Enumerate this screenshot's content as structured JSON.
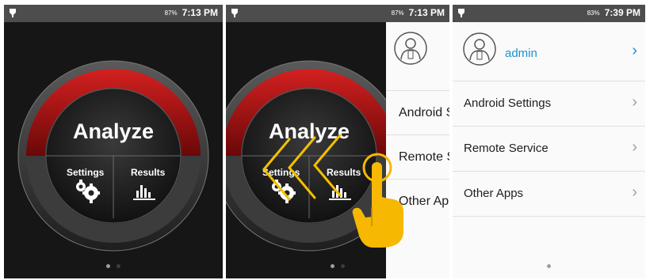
{
  "colors": {
    "accent_red": "#c01818",
    "dial_dark": "#222222",
    "link_blue": "#1e8fcc",
    "hand_yellow": "#f6b800",
    "status_bar": "#4d4d4d"
  },
  "screens": [
    {
      "status": {
        "battery": "87%",
        "time": "7:13 PM",
        "left_icon": "location-pin-icon"
      },
      "dial": {
        "title": "Analyze",
        "left_label": "Settings",
        "right_label": "Results",
        "left_icon": "gears-icon",
        "right_icon": "bar-chart-icon"
      },
      "page_dots": 2
    },
    {
      "status": {
        "battery": "87%",
        "time": "7:13 PM",
        "left_icon": "location-pin-icon"
      },
      "dial": {
        "title": "Analyze",
        "left_label": "Settings",
        "right_label": "Results",
        "left_icon": "gears-icon",
        "right_icon": "bar-chart-icon"
      },
      "drawer": {
        "items": [
          "Android Settings",
          "Remote Service",
          "Other Apps"
        ]
      },
      "gesture": "swipe-left-hand-icon",
      "page_dots": 2
    },
    {
      "status": {
        "battery": "83%",
        "time": "7:39 PM",
        "left_icon": "location-pin-icon"
      },
      "user": {
        "name": "admin",
        "avatar": "user-avatar-icon",
        "chevron": "›"
      },
      "menu": [
        {
          "label": "Android Settings",
          "chevron": "›"
        },
        {
          "label": "Remote Service",
          "chevron": "›"
        },
        {
          "label": "Other Apps",
          "chevron": "›"
        }
      ],
      "page_dots": 2
    }
  ]
}
